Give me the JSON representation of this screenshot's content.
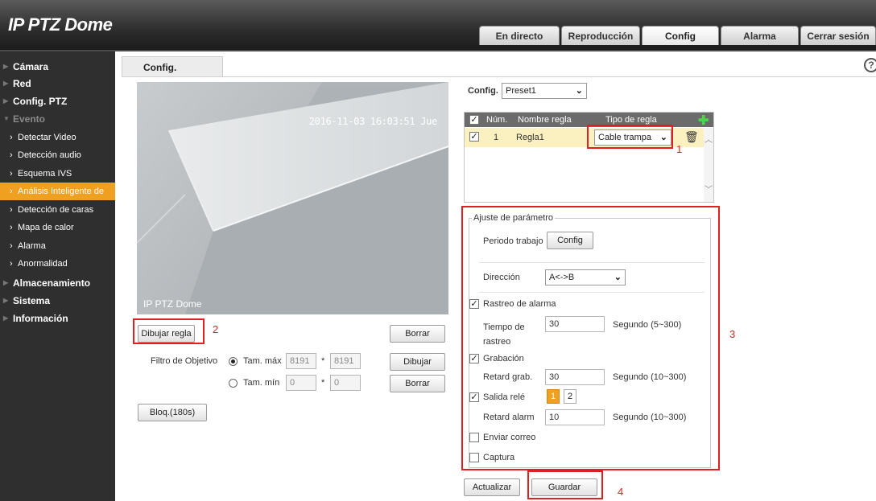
{
  "header": {
    "title": "IP PTZ Dome",
    "tabs": [
      {
        "label": "En directo"
      },
      {
        "label": "Reproducción"
      },
      {
        "label": "Config"
      },
      {
        "label": "Alarma"
      },
      {
        "label": "Cerrar sesión"
      }
    ],
    "active_tab": "Config"
  },
  "sidebar": {
    "items": [
      {
        "label": "Cámara",
        "level": 1
      },
      {
        "label": "Red",
        "level": 1
      },
      {
        "label": "Config. PTZ",
        "level": 1
      },
      {
        "label": "Evento",
        "level": 1,
        "expanded": true
      },
      {
        "label": "Detectar Video",
        "level": 2
      },
      {
        "label": "Detección audio",
        "level": 2
      },
      {
        "label": "Esquema IVS",
        "level": 2
      },
      {
        "label": "Análisis Inteligente de",
        "level": 2,
        "active": true
      },
      {
        "label": "Detección de caras",
        "level": 2
      },
      {
        "label": "Mapa de calor",
        "level": 2
      },
      {
        "label": "Alarma",
        "level": 2
      },
      {
        "label": "Anormalidad",
        "level": 2
      },
      {
        "label": "Almacenamiento",
        "level": 1
      },
      {
        "label": "Sistema",
        "level": 1
      },
      {
        "label": "Información",
        "level": 1
      }
    ]
  },
  "content": {
    "tab_label": "Config.",
    "help_icon": "?"
  },
  "video": {
    "timestamp": "2016-11-03 16:03:51 Jue",
    "channel_name": "IP PTZ Dome"
  },
  "left_controls": {
    "draw_rule": "Dibujar regla",
    "clear_rule": "Borrar",
    "target_filter_label": "Filtro de Objetivo",
    "max_size": {
      "label": "Tam. máx",
      "w": "8191",
      "sep": "*",
      "h": "8191",
      "selected": true
    },
    "min_size": {
      "label": "Tam. mín",
      "w": "0",
      "sep": "*",
      "h": "0",
      "selected": false
    },
    "draw": "Dibujar",
    "clear": "Borrar",
    "lock": "Bloq.(180s)"
  },
  "config_select": {
    "label": "Config.",
    "value": "Preset1"
  },
  "rule_table": {
    "columns": [
      "Núm.",
      "Nombre regla",
      "Tipo de regla"
    ],
    "rows": [
      {
        "checked": true,
        "num": "1",
        "name": "Regla1",
        "type": "Cable trampa"
      }
    ]
  },
  "params": {
    "legend": "Ajuste de parámetro",
    "work_period": {
      "label": "Periodo trabajo",
      "button": "Config"
    },
    "direction": {
      "label": "Dirección",
      "value": "A<->B"
    },
    "alarm_track": {
      "label": "Rastreo de alarma",
      "checked": true
    },
    "track_time": {
      "label": "Tiempo de rastreo",
      "value": "30",
      "unit": "Segundo (5~300)"
    },
    "recording": {
      "label": "Grabación",
      "checked": true
    },
    "record_delay": {
      "label": "Retard grab.",
      "value": "30",
      "unit": "Segundo (10~300)"
    },
    "relay_out": {
      "label": "Salida relé",
      "checked": true,
      "options": [
        "1",
        "2"
      ],
      "selected": "1"
    },
    "alarm_delay": {
      "label": "Retard alarm",
      "value": "10",
      "unit": "Segundo (10~300)"
    },
    "send_email": {
      "label": "Enviar correo",
      "checked": false
    },
    "capture": {
      "label": "Captura",
      "checked": false
    }
  },
  "footer": {
    "refresh": "Actualizar",
    "save": "Guardar"
  },
  "annotations": [
    "1",
    "2",
    "3",
    "4"
  ],
  "colors": {
    "accent": "#f0a020",
    "sidebar_bg": "#2f2f2f",
    "highlight_box": "#e02020",
    "row_selected": "#fbf0c0"
  }
}
